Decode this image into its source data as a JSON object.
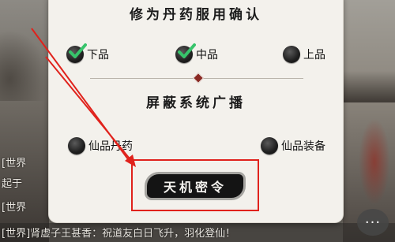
{
  "panel": {
    "title": "修为丹药服用确认",
    "section2_title": "屏蔽系统广播",
    "confirm_button": "天机密令"
  },
  "pill_options": [
    {
      "label": "下品",
      "checked": true
    },
    {
      "label": "中品",
      "checked": true
    },
    {
      "label": "上品",
      "checked": false
    }
  ],
  "broadcast_options": [
    {
      "label": "仙品丹药",
      "checked": false
    },
    {
      "label": "仙品装备",
      "checked": false
    }
  ],
  "chat": {
    "lines": [
      "[世界",
      "起于",
      "[世界",
      "[世界]肾虚子王甚香：祝道友白日飞升，羽化登仙！"
    ],
    "button": "···"
  },
  "colors": {
    "accent_check": "#37c46b",
    "highlight_frame": "#e0221c",
    "button_bg": "#141414"
  }
}
